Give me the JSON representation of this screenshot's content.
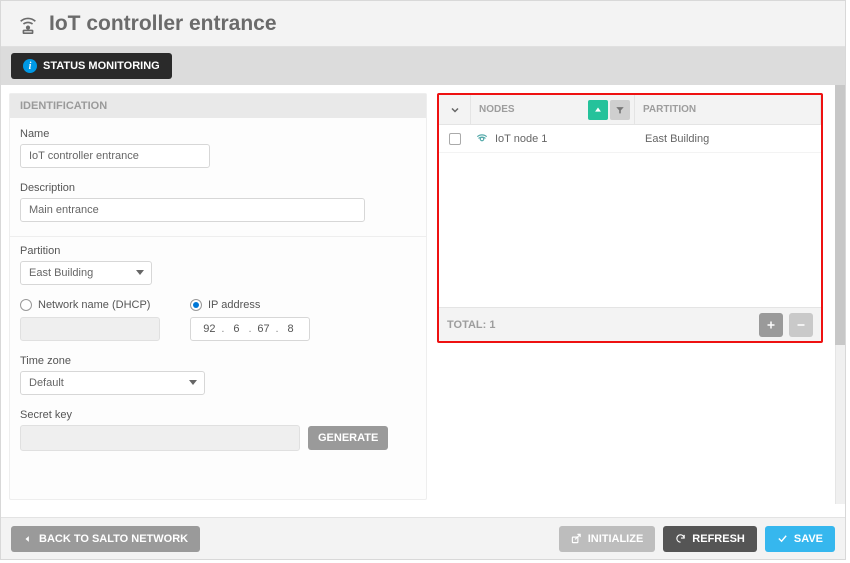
{
  "header": {
    "title": "IoT controller entrance"
  },
  "tabs": {
    "status_monitoring": "STATUS MONITORING"
  },
  "identification": {
    "section_title": "IDENTIFICATION",
    "name_label": "Name",
    "name_value": "IoT controller entrance",
    "description_label": "Description",
    "description_value": "Main entrance",
    "partition_label": "Partition",
    "partition_value": "East Building",
    "network_name_label": "Network name (DHCP)",
    "ip_address_label": "IP address",
    "network_mode": "ip",
    "ip": {
      "o1": "92",
      "o2": "6",
      "o3": "67",
      "o4": "8"
    },
    "timezone_label": "Time zone",
    "timezone_value": "Default",
    "secret_label": "Secret key",
    "generate_label": "GENERATE"
  },
  "nodes_table": {
    "col_nodes": "NODES",
    "col_partition": "PARTITION",
    "rows": [
      {
        "name": "IoT node 1",
        "partition": "East Building"
      }
    ],
    "total_label": "TOTAL:",
    "total_count": "1"
  },
  "footer": {
    "back": "BACK TO SALTO NETWORK",
    "initialize": "INITIALIZE",
    "refresh": "REFRESH",
    "save": "SAVE"
  }
}
